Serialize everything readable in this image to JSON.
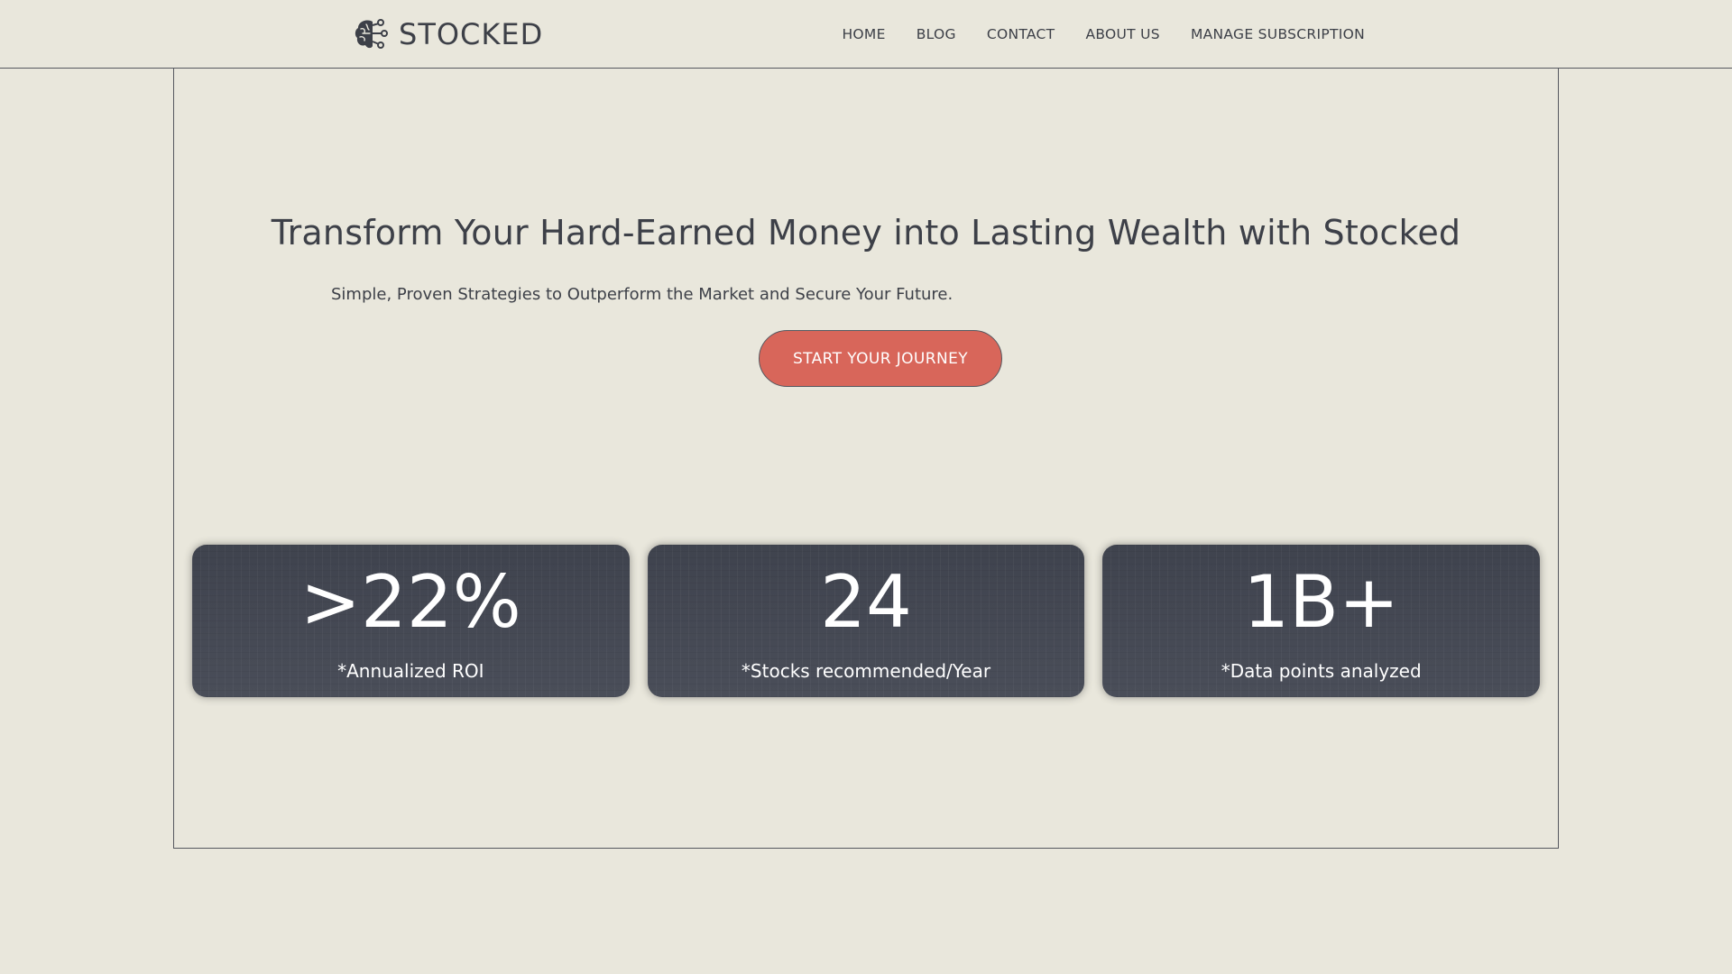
{
  "header": {
    "brand_name": "STOCKED",
    "brand_icon": "brain-circuit-icon",
    "nav": [
      {
        "label": "HOME"
      },
      {
        "label": "BLOG"
      },
      {
        "label": "CONTACT"
      },
      {
        "label": "ABOUT US"
      },
      {
        "label": "MANAGE SUBSCRIPTION"
      }
    ]
  },
  "hero": {
    "title": "Transform Your Hard-Earned Money into Lasting Wealth with Stocked",
    "subtitle": "Simple, Proven Strategies to Outperform the Market and Secure Your Future.",
    "cta_label": "START YOUR JOURNEY"
  },
  "stats": [
    {
      "value": ">22%",
      "label": "*Annualized ROI"
    },
    {
      "value": "24",
      "label": "*Stocks recommended/Year"
    },
    {
      "value": "1B+",
      "label": "*Data points analyzed"
    }
  ],
  "colors": {
    "background": "#e9e7dc",
    "text": "#3d4048",
    "accent": "#d8665a",
    "card": "#464a55"
  }
}
